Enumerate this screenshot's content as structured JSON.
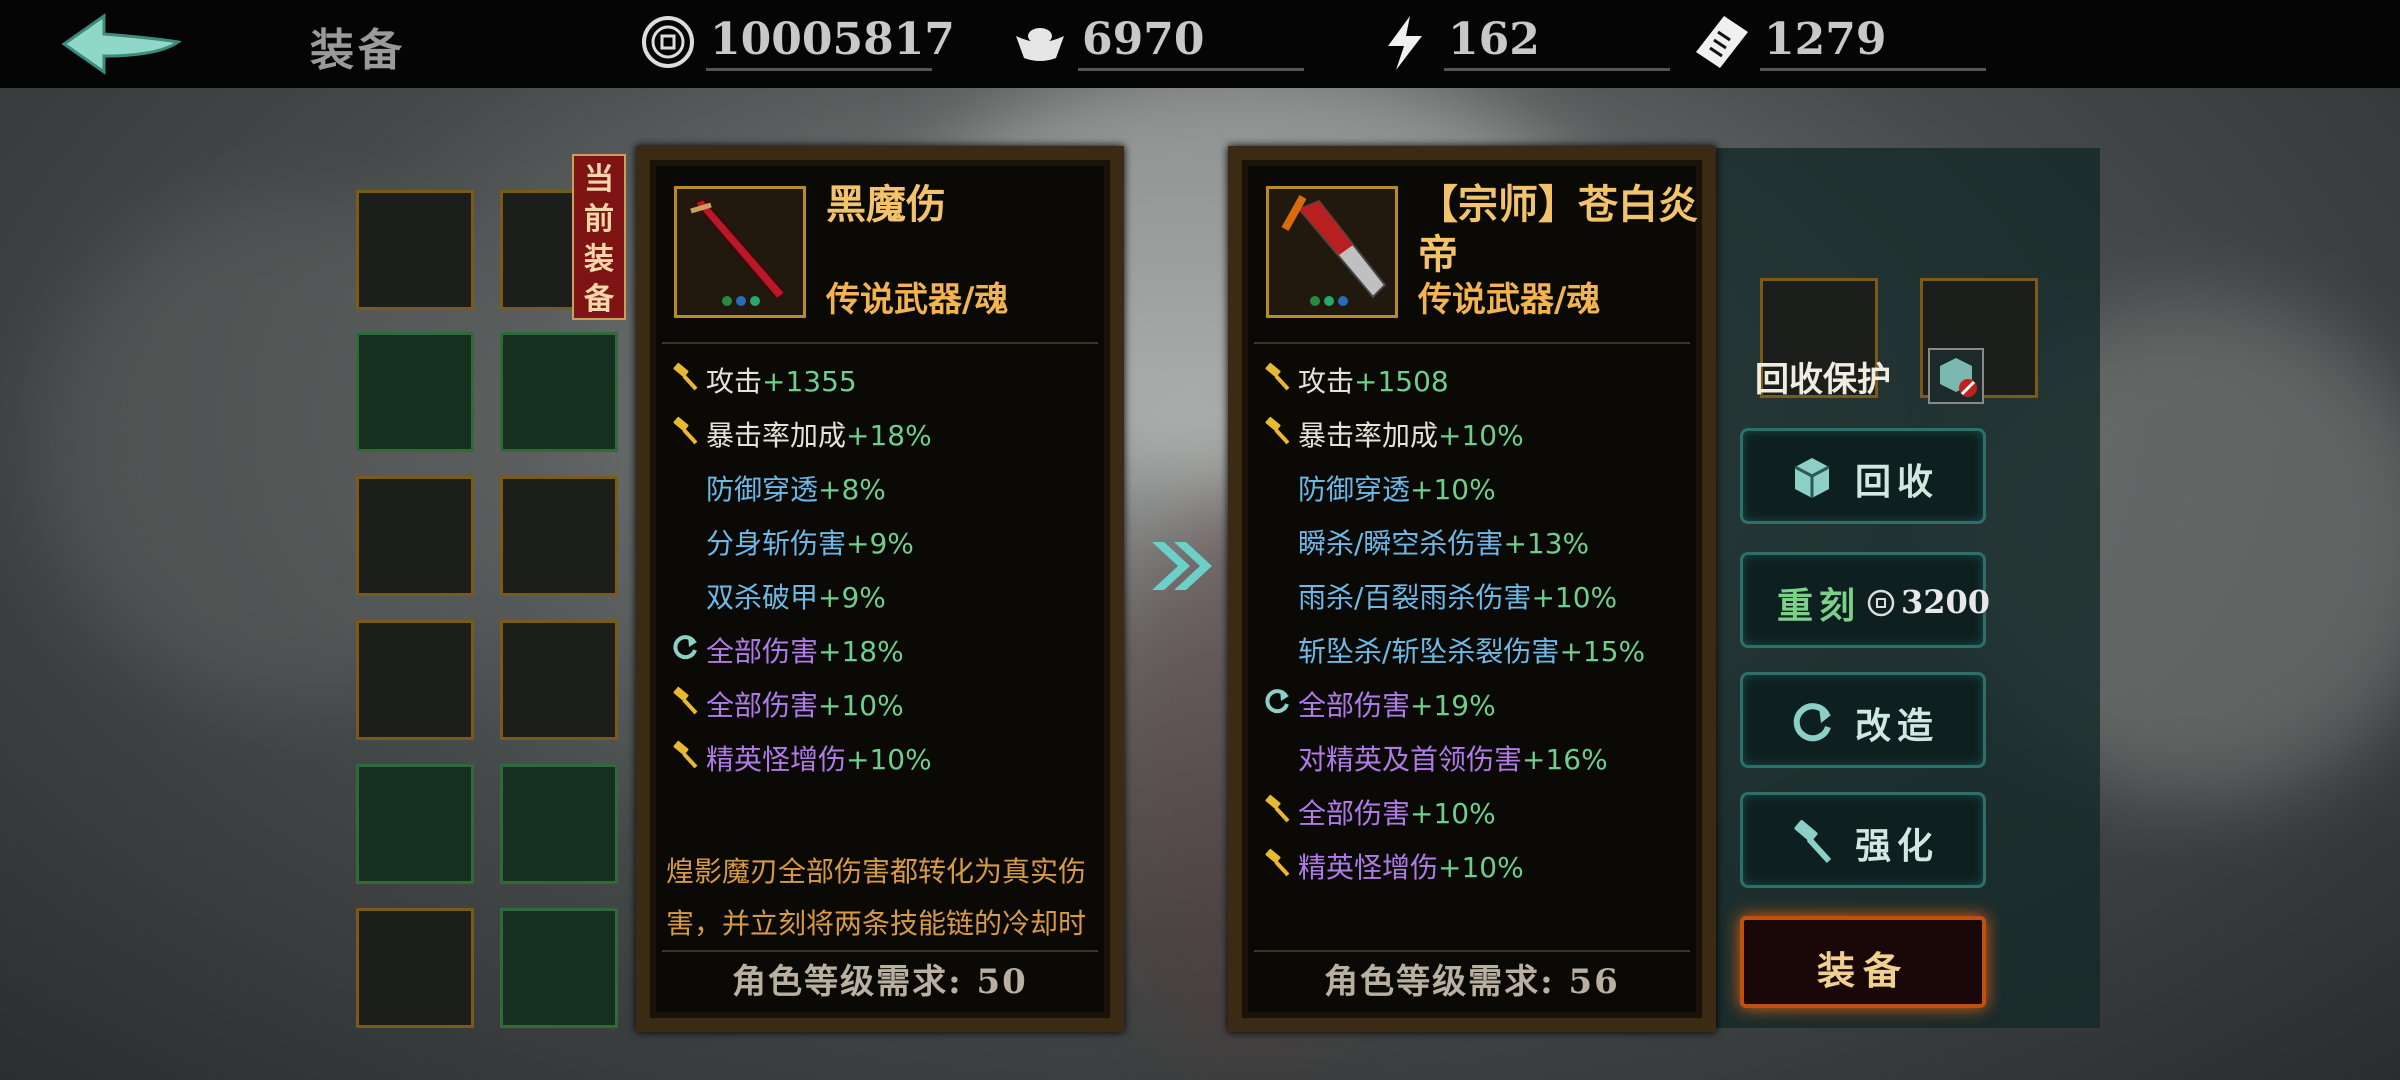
{
  "topbar": {
    "title": "装备",
    "currencies": [
      {
        "icon": "coin-icon",
        "value": "10005817"
      },
      {
        "icon": "silver-ingot-icon",
        "value": "6970"
      },
      {
        "icon": "lightning-icon",
        "value": "162"
      },
      {
        "icon": "ticket-icon",
        "value": "1279"
      }
    ]
  },
  "current_tag": "当前装备",
  "compare_arrow_icon": "double-chevron-right-icon",
  "left_card": {
    "name": "黑魔伤",
    "type": "传说武器/魂",
    "stats": [
      {
        "icon": "hammer-icon",
        "color": "white",
        "label": "攻击",
        "value": "+1355"
      },
      {
        "icon": "hammer-icon",
        "color": "white",
        "label": "暴击率加成",
        "value": "+18%"
      },
      {
        "icon": "",
        "color": "blue",
        "label": "防御穿透",
        "value": "+8%"
      },
      {
        "icon": "",
        "color": "blue",
        "label": "分身斩伤害",
        "value": "+9%"
      },
      {
        "icon": "",
        "color": "blue",
        "label": "双杀破甲",
        "value": "+9%"
      },
      {
        "icon": "refresh-icon",
        "color": "purple",
        "label": "全部伤害",
        "value": "+18%"
      },
      {
        "icon": "hammer-icon",
        "color": "purple",
        "label": "全部伤害",
        "value": "+10%"
      },
      {
        "icon": "hammer-icon",
        "color": "purple",
        "label": "精英怪增伤",
        "value": "+10%"
      }
    ],
    "description": "煌影魔刃全部伤害都转化为真实伤害，并立刻将两条技能链的冷却时",
    "requirement": "角色等级需求: 50"
  },
  "right_card": {
    "name": "【宗师】苍白炎帝",
    "type": "传说武器/魂",
    "stats": [
      {
        "icon": "hammer-icon",
        "color": "white",
        "label": "攻击",
        "value": "+1508"
      },
      {
        "icon": "hammer-icon",
        "color": "white",
        "label": "暴击率加成",
        "value": "+10%"
      },
      {
        "icon": "",
        "color": "blue",
        "label": "防御穿透",
        "value": "+10%"
      },
      {
        "icon": "",
        "color": "blue",
        "label": "瞬杀/瞬空杀伤害",
        "value": "+13%"
      },
      {
        "icon": "",
        "color": "blue",
        "label": "雨杀/百裂雨杀伤害",
        "value": "+10%"
      },
      {
        "icon": "",
        "color": "blue",
        "label": "斩坠杀/斩坠杀裂伤害",
        "value": "+15%"
      },
      {
        "icon": "refresh-icon",
        "color": "purple",
        "label": "全部伤害",
        "value": "+19%"
      },
      {
        "icon": "",
        "color": "purple",
        "label": "对精英及首领伤害",
        "value": "+16%"
      },
      {
        "icon": "hammer-icon",
        "color": "purple",
        "label": "全部伤害",
        "value": "+10%"
      },
      {
        "icon": "hammer-icon",
        "color": "purple",
        "label": "精英怪增伤",
        "value": "+10%"
      }
    ],
    "requirement": "角色等级需求: 56"
  },
  "actions": {
    "recycle_protect": "回收保护",
    "recycle": "回收",
    "reforge": "重刻",
    "reforge_cost": "3200",
    "modify": "改造",
    "enhance": "强化",
    "equip": "装备"
  },
  "colors": {
    "gold": "#f2c36a",
    "green_value": "#6fcf8a",
    "blue_stat": "#6eb8e6",
    "purple_stat": "#b07ae8",
    "teal_button": "#2f6f6a",
    "equip_orange": "#c05010"
  }
}
